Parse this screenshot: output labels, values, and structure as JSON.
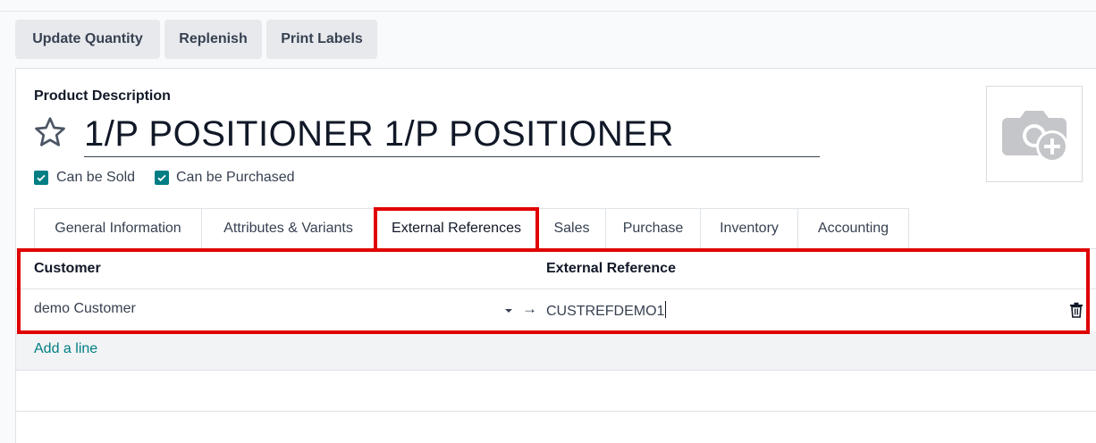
{
  "actions": {
    "update_quantity": "Update Quantity",
    "replenish": "Replenish",
    "print_labels": "Print Labels"
  },
  "product": {
    "description_label": "Product Description",
    "name": "1/P POSITIONER 1/P POSITIONER",
    "can_be_sold": {
      "label": "Can be Sold",
      "checked": true
    },
    "can_be_purchased": {
      "label": "Can be Purchased",
      "checked": true
    }
  },
  "tabs": [
    {
      "label": "General Information",
      "active": false
    },
    {
      "label": "Attributes & Variants",
      "active": false
    },
    {
      "label": "External References",
      "active": true
    },
    {
      "label": "Sales",
      "active": false
    },
    {
      "label": "Purchase",
      "active": false
    },
    {
      "label": "Inventory",
      "active": false
    },
    {
      "label": "Accounting",
      "active": false
    }
  ],
  "external_references": {
    "columns": [
      "Customer",
      "External Reference"
    ],
    "rows": [
      {
        "customer": "demo Customer",
        "reference": "CUSTREFDEMO1"
      }
    ],
    "add_line": "Add a line"
  },
  "icons": {
    "favorite": "star-outline-icon",
    "photo": "camera-add-icon",
    "dropdown": "caret-down-icon",
    "link": "arrow-right-icon",
    "delete": "trash-icon",
    "check": "checkmark-icon"
  },
  "colors": {
    "accent": "#017e84",
    "highlight": "#e00000",
    "button_bg": "#e7e9ed"
  }
}
